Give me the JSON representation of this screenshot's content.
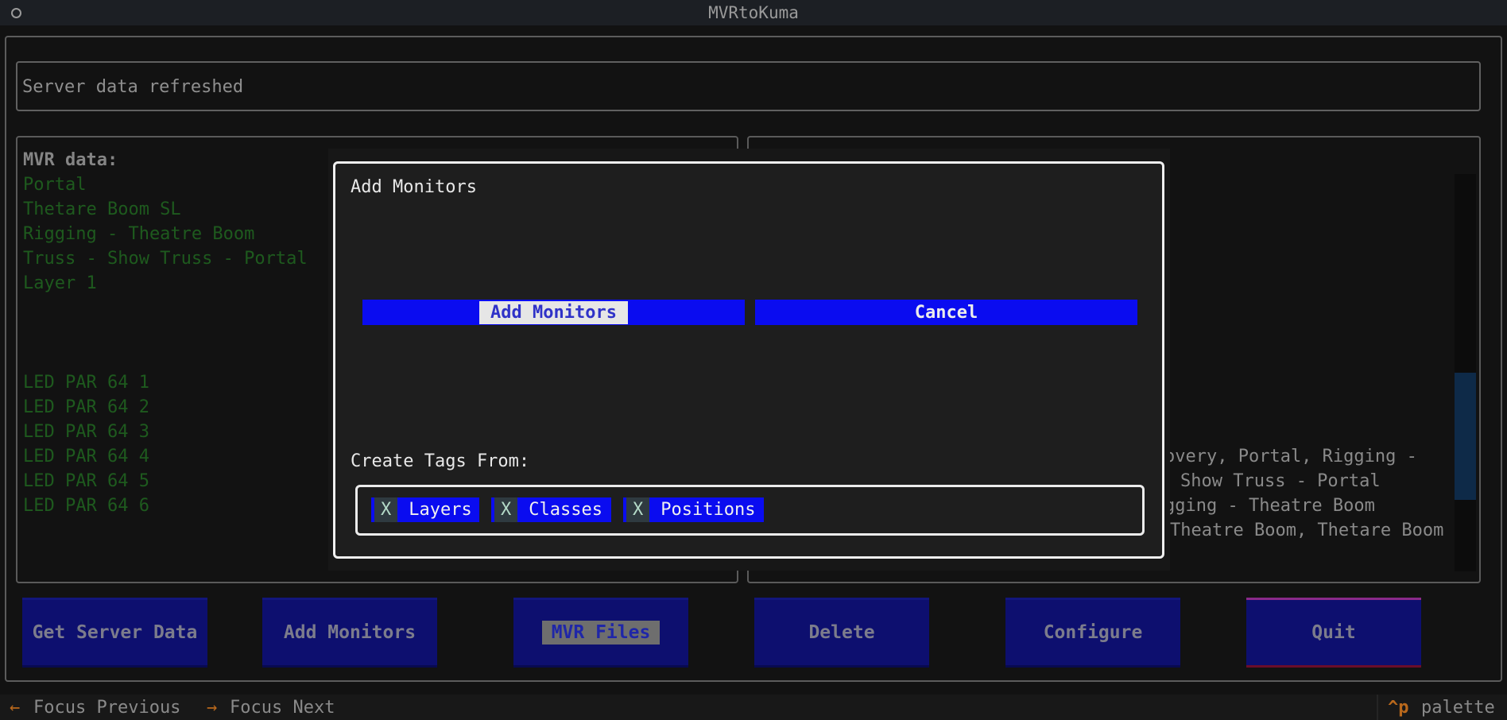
{
  "window": {
    "title": "MVRtoKuma"
  },
  "status": {
    "message": "Server data refreshed"
  },
  "mvr": {
    "heading": "MVR data:",
    "groups": [
      "Portal",
      "Thetare Boom SL",
      "Rigging - Theatre Boom",
      "Truss - Show Truss - Portal",
      "Layer 1"
    ],
    "fixtures": [
      "LED PAR 64 1",
      "LED PAR 64 2",
      "LED PAR 64 3",
      "LED PAR 64 4",
      "LED PAR 64 5",
      "LED PAR 64 6"
    ]
  },
  "right_panel": {
    "lines": [
      "overy, Portal, Rigging -",
      "Show Truss - Portal",
      "gging - Theatre Boom",
      "Theatre Boom, Thetare Boom"
    ]
  },
  "buttons": {
    "get_server_data": "Get Server Data",
    "add_monitors": "Add Monitors",
    "mvr_files": "MVR Files",
    "delete": "Delete",
    "configure": "Configure",
    "quit": "Quit"
  },
  "modal": {
    "title": "Add Monitors",
    "add_label": "Add Monitors",
    "cancel_label": "Cancel",
    "tags_label": "Create Tags From:",
    "tags": [
      {
        "mark": "X",
        "label": "Layers"
      },
      {
        "mark": "X",
        "label": "Classes"
      },
      {
        "mark": "X",
        "label": "Positions"
      }
    ]
  },
  "footer": {
    "prev_key": "←",
    "prev_label": "Focus Previous",
    "next_key": "→",
    "next_label": "Focus Next",
    "palette_key": "^p",
    "palette_label": "palette"
  }
}
